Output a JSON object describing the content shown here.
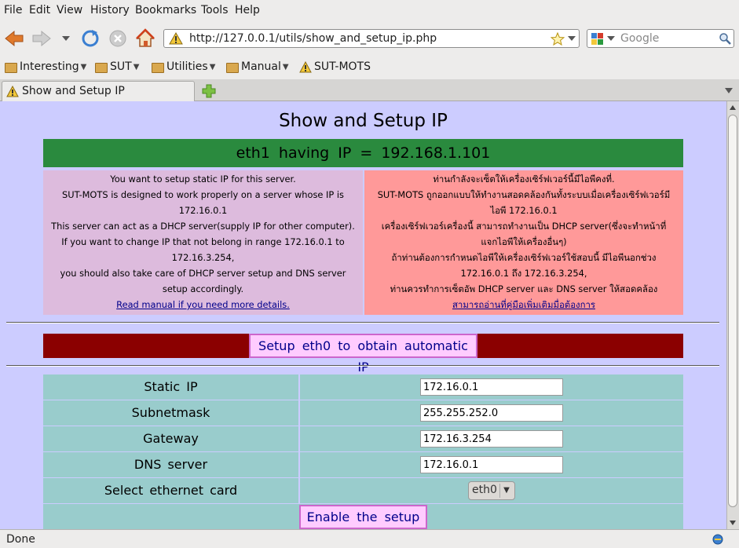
{
  "menu": [
    "File",
    "Edit",
    "View",
    "History",
    "Bookmarks",
    "Tools",
    "Help"
  ],
  "nav": {
    "url": "http://127.0.0.1/utils/show_and_setup_ip.php",
    "search_placeholder": "Google"
  },
  "bookmarks": {
    "items": [
      "Interesting",
      "SUT",
      "Utilities",
      "Manual",
      "SUT-MOTS"
    ]
  },
  "tab": {
    "title": "Show and Setup IP"
  },
  "page": {
    "title": "Show and Setup IP",
    "ip_banner": "eth1 having IP = 192.168.1.101",
    "english": {
      "lines": [
        "You want to setup static IP for this server.",
        "SUT-MOTS is designed to work properly on a server whose IP is",
        "172.16.0.1",
        "This server can act as a DHCP server(supply IP for other computer).",
        "If you want to change IP that not belong in range 172.16.0.1 to",
        "172.16.3.254,",
        "you should also take care of DHCP server setup and DNS server",
        "setup accordingly."
      ],
      "link": "Read manual if you need more details."
    },
    "thai": {
      "lines": [
        "ท่านกำลังจะเซ็ตให้เครื่องเซิร์ฟเวอร์นี้มีไอพีคงที่.",
        "SUT-MOTS ถูกออกแบบให้ทำงานสอดคล้องกันทั้งระบบเมื่อเครื่องเซิร์ฟเวอร์มี",
        "ไอพี 172.16.0.1",
        "เครื่องเซิร์ฟเวอร์เครื่องนี้ สามารถทำงานเป็น DHCP server(ซึ่งจะทำหน้าที่",
        "แจกไอพีให้เครื่องอื่นๆ)",
        "ถ้าท่านต้องการกำหนดไอพีให้เครื่องเซิร์ฟเวอร์ใช้สอบนี้ มีไอพีนอกช่วง",
        "172.16.0.1 ถึง 172.16.3.254,",
        "ท่านควรทำการเซ็ตอัพ DHCP server และ DNS server ให้สอดคล้อง"
      ],
      "link": "สามารถอ่านที่คู่มือเพิ่มเติมมื่อต้องการ"
    },
    "auto_button": "Setup eth0 to obtain automatic IP",
    "form": {
      "static_ip_label": "Static IP",
      "static_ip_value": "172.16.0.1",
      "subnet_label": "Subnetmask",
      "subnet_value": "255.255.252.0",
      "gateway_label": "Gateway",
      "gateway_value": "172.16.3.254",
      "dns_label": "DNS server",
      "dns_value": "172.16.0.1",
      "card_label": "Select ethernet card",
      "card_value": "eth0",
      "submit": "Enable the setup"
    }
  },
  "status": "Done"
}
